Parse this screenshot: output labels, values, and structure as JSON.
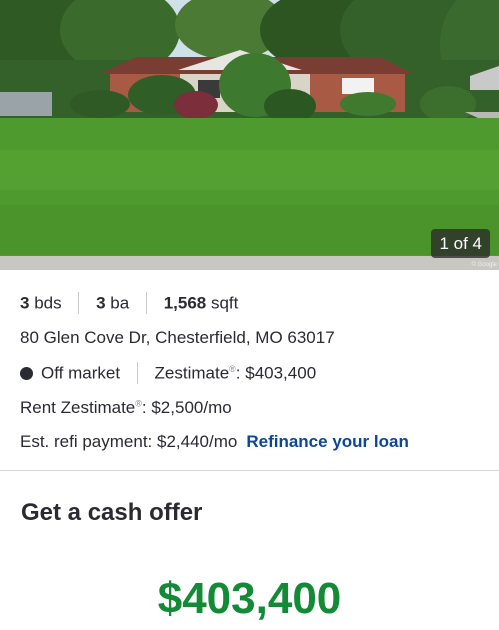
{
  "gallery": {
    "counter": "1 of 4",
    "credit": "© Google"
  },
  "facts": {
    "beds_num": "3",
    "beds_unit": "bds",
    "baths_num": "3",
    "baths_unit": "ba",
    "sqft_num": "1,568",
    "sqft_unit": "sqft",
    "address": "80 Glen Cove Dr, Chesterfield, MO 63017",
    "status": "Off market",
    "zestimate_label": "Zestimate",
    "zestimate_value": ": $403,400",
    "rent_label": "Rent Zestimate",
    "rent_value": ": $2,500/mo",
    "refi_text": "Est. refi payment: $2,440/mo",
    "refi_link": "Refinance your loan",
    "reg_mark": "®"
  },
  "cash_offer": {
    "title": "Get a cash offer",
    "amount": "$403,400"
  },
  "colors": {
    "text": "#2a2a33",
    "link": "#0d4599",
    "offer_green": "#138a36"
  }
}
